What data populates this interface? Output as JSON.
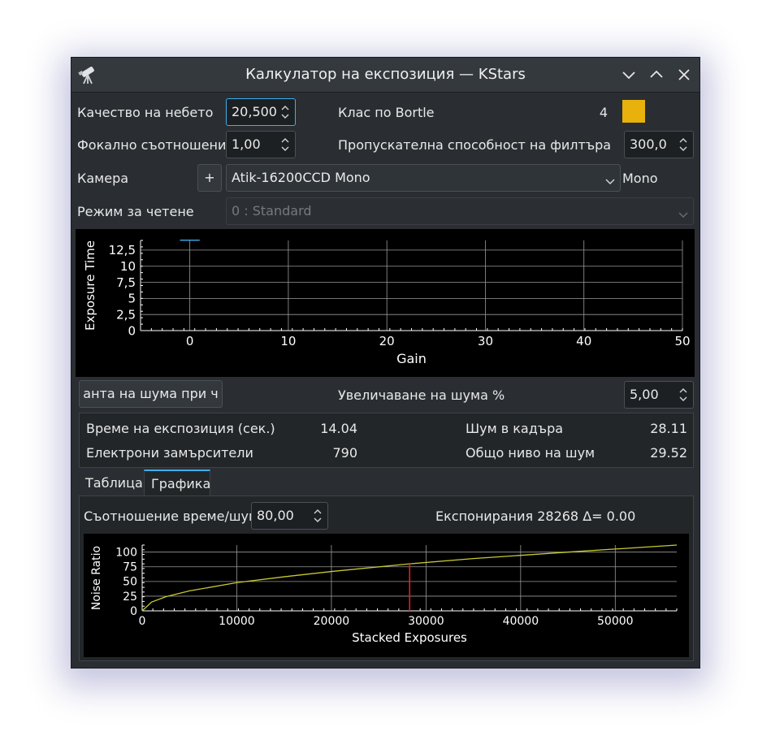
{
  "window": {
    "title": "Калкулатор на експозиция — KStars",
    "icons": {
      "app": "telescope-icon",
      "minimize": "chevron-down-icon",
      "maximize": "chevron-up-icon",
      "close": "close-icon"
    }
  },
  "form": {
    "sky_quality_label": "Качество на небето",
    "sky_quality_value": "20,500",
    "bortle_label": "Клас по Bortle",
    "bortle_value": "4",
    "bortle_color": "#e8b10c",
    "focal_ratio_label": "Фокално съотношение",
    "focal_ratio_value": "1,00",
    "filter_label": "Пропускателна способност на филтъра",
    "filter_value": "300,0",
    "camera_label": "Камера",
    "camera_add_label": "+",
    "camera_value": "Atik-16200CCD Mono",
    "camera_type": "Mono",
    "read_mode_label": "Режим за четене",
    "read_mode_value": "0 : Standard"
  },
  "gain_chart": {
    "chart_data": {
      "type": "line",
      "xlabel": "Gain",
      "ylabel": "Exposure Time",
      "xlim": [
        -5,
        50
      ],
      "ylim": [
        0,
        14
      ],
      "x_ticks": [
        "0",
        "10",
        "20",
        "30",
        "40",
        "50"
      ],
      "y_ticks": [
        "0",
        "2,5",
        "5",
        "7,5",
        "10",
        "12,5"
      ],
      "series": [
        {
          "x": [
            -1,
            1
          ],
          "y": [
            14.04,
            14.04
          ],
          "color": "#3daee9"
        }
      ],
      "grid": true
    }
  },
  "noise": {
    "button_label": "анта на шума при ч",
    "increase_label": "Увеличаване на шума %",
    "increase_value": "5,00"
  },
  "results": {
    "exposure_label": "Време на експозиция (сек.)",
    "exposure_value": "14.04",
    "frame_noise_label": "Шум в кадъра",
    "frame_noise_value": "28.11",
    "electrons_label": "Електрони замърсители",
    "electrons_value": "790",
    "total_noise_label": "Общо ниво на шум",
    "total_noise_value": "29.52"
  },
  "tabs": [
    {
      "label": "Таблица"
    },
    {
      "label": "Графика"
    }
  ],
  "graph_tab": {
    "ratio_label": "Съотношение време/шум",
    "ratio_value": "80,00",
    "exposures_text": "Експонирания 28268 Δ= 0.00"
  },
  "noise_chart": {
    "chart_data": {
      "type": "line",
      "xlabel": "Stacked Exposures",
      "ylabel": "Noise Ratio",
      "xlim": [
        0,
        56500
      ],
      "ylim": [
        0,
        112
      ],
      "x_ticks": [
        "0",
        "10000",
        "20000",
        "30000",
        "40000",
        "50000"
      ],
      "y_ticks": [
        "0",
        "25",
        "50",
        "75",
        "100"
      ],
      "series": [
        {
          "x": [
            0,
            1000,
            2500,
            5000,
            10000,
            15000,
            20000,
            28268,
            35000,
            45000,
            56500
          ],
          "y": [
            0,
            15,
            24,
            34,
            48,
            58,
            67,
            80,
            89,
            100,
            112
          ],
          "color": "#c8c832"
        }
      ],
      "marker": {
        "x": 28268,
        "y": 80,
        "color": "#e02020"
      },
      "grid": true
    }
  }
}
